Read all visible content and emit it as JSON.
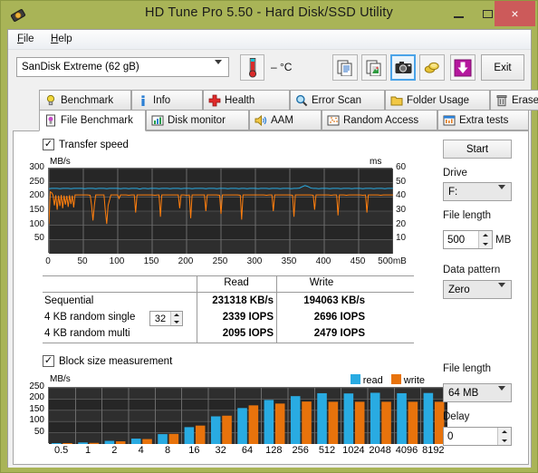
{
  "window": {
    "title": "HD Tune Pro 5.50 - Hard Disk/SSD Utility",
    "icon": "hdd-icon",
    "minimize_label": "–",
    "maximize_label": "□",
    "close_label": "×",
    "border_color": "#a9b457",
    "close_color": "#cc5a5a"
  },
  "menu": {
    "items": [
      {
        "label": "File",
        "mnemonic": "F"
      },
      {
        "label": "Help",
        "mnemonic": "H"
      }
    ]
  },
  "toolbar": {
    "drive_selected": "SanDisk Extreme (62 gB)",
    "temperature": "– °C",
    "thermometer_icon": "thermometer-icon",
    "buttons": [
      {
        "name": "copy-text-icon",
        "label": ""
      },
      {
        "name": "copy-image-icon",
        "label": ""
      },
      {
        "name": "camera-icon",
        "label": ""
      },
      {
        "name": "coins-icon",
        "label": ""
      },
      {
        "name": "download-icon",
        "label": ""
      }
    ],
    "exit_label": "Exit"
  },
  "tabs": {
    "row1": [
      {
        "label": "Benchmark",
        "icon": "bulb-icon",
        "active": false
      },
      {
        "label": "Info",
        "icon": "info-icon",
        "active": false
      },
      {
        "label": "Health",
        "icon": "cross-icon",
        "active": false
      },
      {
        "label": "Error Scan",
        "icon": "magnifier-icon",
        "active": false
      },
      {
        "label": "Folder Usage",
        "icon": "folder-icon",
        "active": false
      },
      {
        "label": "Erase",
        "icon": "trash-icon",
        "active": false
      }
    ],
    "row2": [
      {
        "label": "File Benchmark",
        "icon": "file-benchmark-icon",
        "active": true
      },
      {
        "label": "Disk monitor",
        "icon": "bar-chart-icon",
        "active": false
      },
      {
        "label": "AAM",
        "icon": "speaker-icon",
        "active": false
      },
      {
        "label": "Random Access",
        "icon": "scatter-icon",
        "active": false
      },
      {
        "label": "Extra tests",
        "icon": "grid-chart-icon",
        "active": false
      }
    ]
  },
  "transfer_section": {
    "checkbox_label": "Transfer speed",
    "checked": true
  },
  "block_section": {
    "checkbox_label": "Block size measurement",
    "checked": true
  },
  "results": {
    "columns": [
      "",
      "Read",
      "Write"
    ],
    "rows": [
      {
        "label": "Sequential",
        "read": "231318 KB/s",
        "write": "194063 KB/s",
        "spinner": null
      },
      {
        "label": "4 KB random single",
        "read": "2339 IOPS",
        "write": "2696 IOPS",
        "spinner": null
      },
      {
        "label": "4 KB random multi",
        "read": "2095 IOPS",
        "write": "2479 IOPS",
        "spinner": "32"
      }
    ]
  },
  "right_panel": {
    "start_label": "Start",
    "drive_label": "Drive",
    "drive_value": "F:",
    "file_length_label": "File length",
    "file_length_value": "500",
    "file_length_unit": "MB",
    "data_pattern_label": "Data pattern",
    "data_pattern_value": "Zero",
    "block_file_length_label": "File length",
    "block_file_length_value": "64 MB",
    "delay_label": "Delay",
    "delay_value": "0"
  },
  "chart_data": [
    {
      "type": "line",
      "name": "transfer-speed-chart",
      "title": "",
      "ylabel": "MB/s",
      "y2label": "ms",
      "xlabel": "",
      "xlim": [
        0,
        500
      ],
      "ylim": [
        0,
        300
      ],
      "y2lim": [
        0,
        60
      ],
      "xticks": [
        0,
        50,
        100,
        150,
        200,
        250,
        300,
        350,
        400,
        450,
        500
      ],
      "xticklabels": [
        "0",
        "50",
        "100",
        "150",
        "200",
        "250",
        "300",
        "350",
        "400",
        "450",
        "500mB"
      ],
      "yticks": [
        50,
        100,
        150,
        200,
        250,
        300
      ],
      "y2ticks": [
        10,
        20,
        30,
        40,
        50,
        60
      ],
      "grid": true,
      "background": "#111111",
      "series": [
        {
          "name": "read",
          "color": "#29abe2",
          "x": [
            0,
            4,
            8,
            12,
            16,
            20,
            24,
            28,
            32,
            36,
            40,
            44,
            48,
            52,
            56,
            60,
            64,
            68,
            72,
            76,
            80,
            84,
            88,
            92,
            96,
            100,
            104,
            108,
            112,
            116,
            120,
            124,
            128,
            132,
            136,
            140,
            144,
            148,
            152,
            156,
            160,
            164,
            168,
            172,
            176,
            180,
            184,
            188,
            192,
            196,
            200,
            204,
            208,
            212,
            216,
            220,
            224,
            228,
            232,
            236,
            240,
            244,
            248,
            252,
            256,
            260,
            264,
            268,
            272,
            276,
            280,
            284,
            288,
            292,
            296,
            300,
            304,
            308,
            312,
            316,
            320,
            324,
            328,
            332,
            336,
            340,
            344,
            348,
            352,
            356,
            360,
            364,
            368,
            372,
            376,
            380,
            384,
            388,
            392,
            396,
            400,
            404,
            408,
            412,
            416,
            420,
            424,
            428,
            432,
            436,
            440,
            444,
            448,
            452,
            456,
            460,
            464,
            468,
            472,
            476,
            480,
            484,
            488,
            492,
            496,
            500
          ],
          "y": [
            229,
            230,
            230,
            230,
            229,
            230,
            230,
            230,
            229,
            230,
            230,
            230,
            230,
            229,
            230,
            230,
            230,
            229,
            230,
            230,
            230,
            229,
            230,
            230,
            230,
            230,
            229,
            230,
            230,
            229,
            230,
            230,
            230,
            228,
            230,
            230,
            229,
            230,
            230,
            230,
            229,
            230,
            230,
            230,
            229,
            230,
            230,
            230,
            229,
            230,
            230,
            230,
            229,
            230,
            230,
            230,
            230,
            229,
            230,
            230,
            230,
            229,
            230,
            230,
            230,
            229,
            230,
            230,
            230,
            229,
            230,
            230,
            229,
            230,
            230,
            230,
            229,
            230,
            230,
            230,
            229,
            230,
            230,
            230,
            229,
            230,
            230,
            230,
            229,
            230,
            230,
            231,
            236,
            240,
            237,
            232,
            230,
            230,
            229,
            230,
            230,
            230,
            229,
            230,
            230,
            230,
            229,
            230,
            230,
            230,
            229,
            230,
            230,
            230,
            229,
            230,
            230,
            230,
            229,
            230,
            230,
            230,
            229,
            230,
            230,
            230
          ]
        },
        {
          "name": "write",
          "color": "#ff7f0e",
          "x": [
            0,
            2,
            4,
            6,
            8,
            10,
            12,
            14,
            16,
            18,
            20,
            22,
            24,
            26,
            28,
            30,
            32,
            34,
            36,
            38,
            40,
            44,
            48,
            52,
            56,
            60,
            62,
            64,
            66,
            68,
            72,
            76,
            80,
            82,
            84,
            86,
            90,
            94,
            98,
            100,
            102,
            104,
            108,
            112,
            116,
            120,
            124,
            126,
            128,
            130,
            134,
            138,
            142,
            146,
            150,
            154,
            158,
            160,
            162,
            164,
            168,
            172,
            176,
            180,
            184,
            188,
            190,
            192,
            194,
            196,
            200,
            204,
            206,
            208,
            210,
            214,
            218,
            222,
            226,
            228,
            230,
            232,
            236,
            240,
            244,
            248,
            250,
            252,
            254,
            258,
            262,
            266,
            270,
            274,
            278,
            280,
            282,
            284,
            288,
            292,
            296,
            300,
            304,
            308,
            312,
            316,
            320,
            324,
            326,
            328,
            330,
            334,
            338,
            342,
            346,
            350,
            354,
            356,
            358,
            360,
            364,
            368,
            372,
            376,
            380,
            384,
            386,
            388,
            390,
            394,
            398,
            402,
            406,
            410,
            414,
            418,
            420,
            422,
            424,
            428,
            432,
            436,
            440,
            444,
            448,
            452,
            456,
            460,
            462,
            464,
            466,
            470,
            474,
            478,
            482,
            486,
            490,
            494,
            498,
            500
          ],
          "y": [
            105,
            218,
            215,
            206,
            170,
            206,
            155,
            205,
            168,
            207,
            160,
            205,
            173,
            204,
            165,
            206,
            175,
            205,
            163,
            207,
            207,
            207,
            207,
            207,
            207,
            206,
            170,
            117,
            170,
            207,
            207,
            207,
            207,
            150,
            105,
            170,
            207,
            207,
            207,
            207,
            195,
            207,
            207,
            207,
            206,
            207,
            207,
            145,
            207,
            207,
            207,
            207,
            207,
            207,
            207,
            206,
            207,
            207,
            130,
            207,
            207,
            207,
            207,
            207,
            207,
            207,
            160,
            207,
            207,
            207,
            206,
            207,
            125,
            207,
            207,
            207,
            207,
            207,
            207,
            150,
            207,
            207,
            207,
            207,
            207,
            206,
            140,
            207,
            207,
            207,
            207,
            207,
            207,
            207,
            206,
            120,
            207,
            207,
            207,
            207,
            207,
            207,
            207,
            207,
            207,
            206,
            207,
            207,
            150,
            207,
            207,
            207,
            207,
            207,
            207,
            207,
            206,
            130,
            207,
            207,
            207,
            207,
            207,
            207,
            207,
            206,
            155,
            207,
            207,
            207,
            207,
            207,
            207,
            206,
            207,
            207,
            135,
            207,
            207,
            207,
            206,
            207,
            207,
            207,
            207,
            207,
            206,
            207,
            145,
            207,
            207,
            207,
            207,
            207,
            206,
            207,
            207,
            207,
            207,
            207
          ]
        }
      ]
    },
    {
      "type": "bar",
      "name": "block-size-chart",
      "title": "",
      "ylabel": "MB/s",
      "xlabel": "",
      "categories": [
        "0.5",
        "1",
        "2",
        "4",
        "8",
        "16",
        "32",
        "64",
        "128",
        "256",
        "512",
        "1024",
        "2048",
        "4096",
        "8192"
      ],
      "ylim": [
        0,
        250
      ],
      "yticks": [
        50,
        100,
        150,
        200,
        250
      ],
      "grid": true,
      "background": "#111111",
      "legend": [
        "read",
        "write"
      ],
      "legend_position": "top-right",
      "series": [
        {
          "name": "read",
          "color": "#29abe2",
          "values": [
            3,
            7,
            14,
            24,
            44,
            75,
            123,
            160,
            196,
            213,
            226,
            225,
            228,
            226,
            227
          ]
        },
        {
          "name": "write",
          "color": "#e8730c",
          "values": [
            2,
            5,
            12,
            22,
            45,
            82,
            126,
            172,
            180,
            189,
            188,
            188,
            188,
            188,
            188
          ]
        }
      ]
    }
  ]
}
